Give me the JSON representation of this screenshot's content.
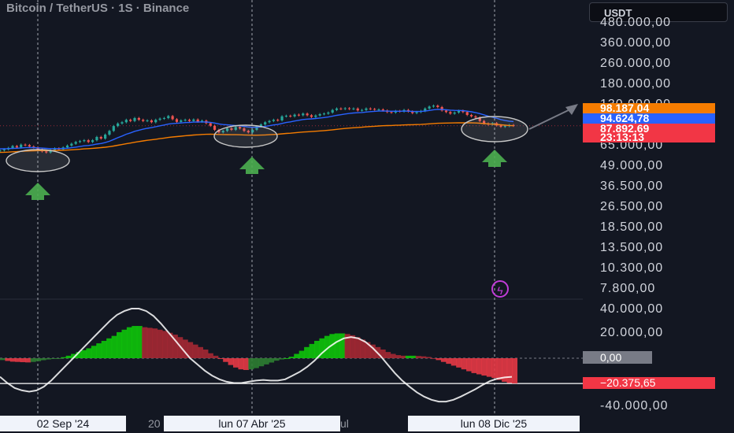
{
  "header": {
    "title": "Bitcoin / TetherUS · 1S · Binance",
    "currency": "USDT"
  },
  "colors": {
    "background": "#131722",
    "up": "#26a69a",
    "down": "#ef5350",
    "ema_fast": "#2962ff",
    "ema_slow": "#f57c00",
    "hist_up": "#0ec40a",
    "hist_down": "#a52833",
    "signal": "#ffffff",
    "arrow": "#4caf50",
    "circle": "#c8c8c8"
  },
  "price_axis": {
    "scale": "log",
    "ticks": [
      "480.000,00",
      "360.000,00",
      "260.000,00",
      "180.000,00",
      "130.000,00",
      "65.000,00",
      "49.000,00",
      "36.500,00",
      "26.500,00",
      "18.500,00",
      "13.500,00",
      "10.300,00",
      "7.800,00"
    ]
  },
  "price_tags": [
    {
      "label": "98.187,04",
      "color": "#f57c00"
    },
    {
      "label": "94.624,78",
      "color": "#2962ff"
    },
    {
      "label": "87.892,69",
      "color": "#f23645"
    },
    {
      "label": "23:13:13",
      "color": "#f23645"
    }
  ],
  "macd_axis": {
    "ticks": [
      "40.000,00",
      "20.000,00",
      "-40.000,00"
    ],
    "zero_label": "0,00",
    "current_label": "−20.375,65"
  },
  "time_axis": {
    "labels": [
      "02 Sep '24",
      "20",
      "lun 07 Abr '25",
      "ul",
      "lun 08 Dic '25"
    ]
  },
  "chart_data": {
    "type": "candlestick",
    "title": "Bitcoin / TetherUS · 1S · Binance",
    "interval": "1S",
    "price_axis_scale": "log",
    "price_ylim": [
      7800,
      480000
    ],
    "weekly_close_approx": [
      57500,
      58500,
      60000,
      62000,
      60500,
      63500,
      63000,
      61500,
      60500,
      58500,
      56500,
      55500,
      57500,
      59500,
      58500,
      60500,
      62500,
      64500,
      66500,
      67500,
      68500,
      66500,
      68500,
      72500,
      70500,
      75500,
      80500,
      87500,
      91500,
      93500,
      97500,
      95500,
      100500,
      97500,
      95500,
      96500,
      93500,
      97500,
      99500,
      100500,
      104000,
      98500,
      94000,
      96500,
      97500,
      95500,
      98000,
      94500,
      96000,
      92000,
      88000,
      82000,
      78500,
      80500,
      84000,
      82000,
      86000,
      84000,
      80500,
      78500,
      82000,
      87000,
      90000,
      93500,
      95500,
      97500,
      96500,
      103500,
      104500,
      103500,
      106500,
      105500,
      108500,
      105500,
      102500,
      105000,
      107500,
      108500,
      110500,
      115500,
      118500,
      117500,
      119000,
      117500,
      118500,
      114500,
      115500,
      118500,
      117500,
      116500,
      116500,
      114500,
      111500,
      110500,
      113500,
      112500,
      115500,
      112500,
      109500,
      111500,
      113500,
      118500,
      122500,
      124500,
      121500,
      114500,
      111500,
      108500,
      110500,
      114000,
      111500,
      106000,
      103500,
      101500,
      95500,
      91500,
      90000,
      92000,
      88500,
      86500,
      87500,
      89000,
      87900
    ],
    "ema_fast_approx": [
      59000,
      59100,
      59300,
      59600,
      59700,
      60000,
      60200,
      60300,
      60300,
      60100,
      59800,
      59500,
      59300,
      59300,
      59300,
      59400,
      59700,
      60200,
      60800,
      61500,
      62200,
      62600,
      63200,
      64100,
      64700,
      65800,
      67300,
      69400,
      71600,
      73700,
      76000,
      77800,
      79900,
      81500,
      82900,
      84200,
      85200,
      86500,
      87900,
      89100,
      90600,
      91400,
      91800,
      92300,
      92900,
      93200,
      93700,
      93800,
      94000,
      93800,
      93300,
      92200,
      90800,
      89800,
      89300,
      88700,
      88400,
      87900,
      87100,
      86100,
      85600,
      85700,
      86200,
      87000,
      88000,
      89200,
      90000,
      91600,
      93000,
      94100,
      95500,
      96600,
      98000,
      98700,
      99000,
      99700,
      100500,
      101400,
      102300,
      103700,
      105300,
      106500,
      107800,
      108800,
      109700,
      110200,
      110600,
      111500,
      112200,
      112800,
      113400,
      113500,
      113300,
      113000,
      113100,
      113000,
      113300,
      113200,
      112700,
      112500,
      112600,
      113300,
      114500,
      115900,
      116700,
      116500,
      116000,
      115200,
      114700,
      114600,
      114300,
      113200,
      111900,
      110500,
      108500,
      106100,
      103800,
      102100,
      100100,
      97900,
      96300,
      95200,
      94600
    ],
    "ema_slow_approx": [
      55500,
      55650,
      55850,
      56100,
      56300,
      56550,
      56800,
      57000,
      57150,
      57250,
      57300,
      57300,
      57350,
      57450,
      57500,
      57600,
      57800,
      58050,
      58350,
      58650,
      59000,
      59250,
      59550,
      59950,
      60300,
      60750,
      61300,
      62000,
      62800,
      63600,
      64500,
      65300,
      66200,
      67000,
      67700,
      68400,
      69000,
      69700,
      70400,
      71100,
      71900,
      72500,
      73000,
      73500,
      74100,
      74500,
      75000,
      75300,
      75700,
      75900,
      76000,
      75900,
      75700,
      75600,
      75500,
      75400,
      75400,
      75300,
      75100,
      74900,
      74800,
      74800,
      74900,
      75100,
      75400,
      75700,
      76000,
      76500,
      77000,
      77400,
      77900,
      78400,
      78900,
      79300,
      79600,
      80000,
      80500,
      80900,
      81400,
      82000,
      82700,
      83300,
      83900,
      84500,
      85000,
      85400,
      85800,
      86300,
      86800,
      87200,
      87600,
      88000,
      88200,
      88400,
      88700,
      88900,
      89200,
      89400,
      89600,
      89800,
      90000,
      90400,
      90900,
      91400,
      91800,
      92000,
      92200,
      92300,
      92400,
      92600,
      92700,
      92600,
      92500,
      92300,
      91900,
      91300,
      90800,
      90400,
      89900,
      89400,
      88900,
      88400,
      88000
    ],
    "markers": [
      {
        "type": "circle",
        "date": "02 Sep '24"
      },
      {
        "type": "circle",
        "date": "lun 07 Abr '25"
      },
      {
        "type": "circle",
        "date": "lun 08 Dic '25"
      },
      {
        "type": "arrow-up",
        "date": "02 Sep '24"
      },
      {
        "type": "arrow-up",
        "date": "lun 07 Abr '25"
      },
      {
        "type": "arrow-up",
        "date": "lun 08 Dic '25"
      }
    ],
    "price_levels": {
      "ema_slow_last": 98187.04,
      "ema_fast_last": 94624.78,
      "last": 87892.69,
      "countdown": "23:13:13"
    },
    "macd": {
      "ylim": [
        -45000,
        42000
      ],
      "current": -20375.65,
      "histogram_approx": [
        -1500,
        -2200,
        -2800,
        -3000,
        -3200,
        -3400,
        -3000,
        -2400,
        -1600,
        -1000,
        -600,
        -200,
        800,
        2000,
        3500,
        5000,
        6500,
        8000,
        10000,
        12000,
        14000,
        16000,
        18000,
        21000,
        23000,
        25000,
        26000,
        26000,
        25000,
        24500,
        24000,
        23000,
        22000,
        20500,
        19000,
        17000,
        15000,
        13000,
        11000,
        9000,
        7000,
        4000,
        2000,
        -500,
        -3000,
        -5500,
        -7500,
        -9000,
        -9500,
        -9000,
        -8000,
        -6500,
        -5000,
        -3500,
        -2000,
        -1000,
        0,
        1200,
        3500,
        6000,
        9000,
        11500,
        14000,
        16000,
        18000,
        19500,
        20000,
        20000,
        19500,
        18500,
        17000,
        15000,
        13000,
        11000,
        9000,
        7000,
        5000,
        3500,
        2500,
        2000,
        2000,
        2000,
        1800,
        1500,
        1000,
        0,
        -1500,
        -3000,
        -4500,
        -6000,
        -7500,
        -9000,
        -10500,
        -12000,
        -13000,
        -14000,
        -15000,
        -16000,
        -17500,
        -19000,
        -20000,
        -20375
      ],
      "signal_approx": [
        -15000,
        -20000,
        -24000,
        -26000,
        -27000,
        -26000,
        -23000,
        -18000,
        -12000,
        -6000,
        0,
        6000,
        12000,
        18000,
        24000,
        30000,
        35000,
        38000,
        40000,
        40000,
        38000,
        34000,
        28000,
        21000,
        14000,
        7000,
        0,
        -5000,
        -10000,
        -14000,
        -17000,
        -19000,
        -20000,
        -20000,
        -19000,
        -18000,
        -17500,
        -18000,
        -18000,
        -17000,
        -14000,
        -11000,
        -7000,
        -2000,
        4000,
        9000,
        13000,
        16000,
        17000,
        16000,
        13000,
        8000,
        2000,
        -5000,
        -12000,
        -18000,
        -23000,
        -27500,
        -31000,
        -33500,
        -35000,
        -35000,
        -33500,
        -31000,
        -28000,
        -25000,
        -21500,
        -18500,
        -16500,
        -15500,
        -15000
      ]
    }
  }
}
